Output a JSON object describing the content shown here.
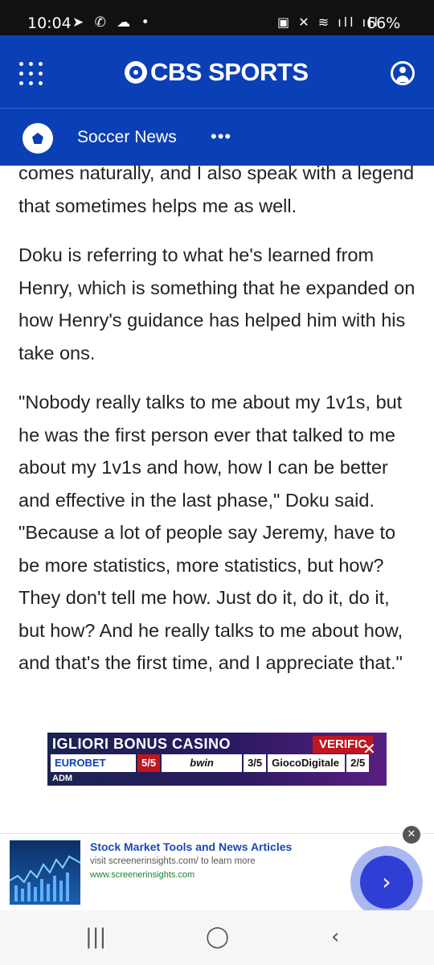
{
  "status_bar": {
    "time": "10:04",
    "left_icons": "➤ ✆ ☁ •",
    "right_icons": "▣ ✕ ≋ ıll ıll",
    "battery": "66%"
  },
  "header": {
    "menu_icon": "grid-menu-icon",
    "logo_text": "CBS SPORTS",
    "account_icon": "account-icon"
  },
  "subnav": {
    "section_title": "Soccer News",
    "more_label": "•••"
  },
  "article": {
    "paragraphs": [
      "comes naturally, and I also speak with a legend that sometimes helps me as well.",
      "Doku is referring to what he's learned from Henry, which is something that he expanded on how Henry's guidance has helped him with his take ons.",
      "\"Nobody really talks to me about my 1v1s, but he was the first person ever that talked to me about my 1v1s and how, how I can be better and effective in the last phase,\" Doku said. \"Because a lot of people say Jeremy, have to be more statistics, more statistics, but how? They don't tell me how. Just do it, do it, do it, but how? And he really talks to me about how, and that's the first time, and I appreciate that.\""
    ]
  },
  "ad_banner": {
    "headline": "IGLIORI BONUS CASINO",
    "verify": "VERIFIC",
    "brands": [
      {
        "name": "EUROBET",
        "odds": "5/5"
      },
      {
        "name": "bwin",
        "odds": "3/5"
      },
      {
        "name": "GiocoDigitale",
        "odds": "2/5"
      }
    ],
    "footer": "ADM"
  },
  "sticky_ad": {
    "headline": "Stock Market Tools and News Articles",
    "description": "visit screenerinsights.com/ to learn more",
    "url": "www.screenerinsights.com",
    "cta_arrow": "›",
    "close": "✕"
  },
  "nav_bar": {
    "recent": "|||",
    "home": "◯",
    "back": "‹"
  }
}
